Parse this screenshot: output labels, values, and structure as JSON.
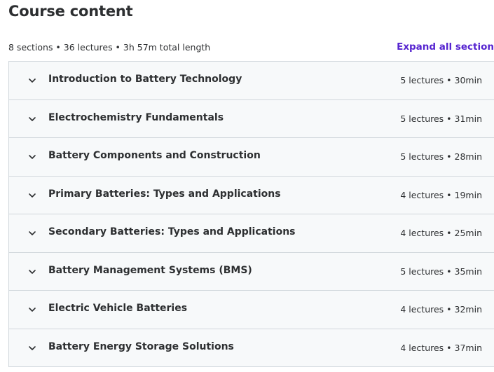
{
  "header": {
    "title": "Course content",
    "summary": "8 sections • 36 lectures • 3h 57m total length",
    "expand_label": "Expand all section"
  },
  "sections": [
    {
      "title": "Introduction to Battery Technology",
      "meta": "5 lectures • 30min"
    },
    {
      "title": "Electrochemistry Fundamentals",
      "meta": "5 lectures • 31min"
    },
    {
      "title": "Battery Components and Construction",
      "meta": "5 lectures • 28min"
    },
    {
      "title": "Primary Batteries: Types and Applications",
      "meta": "4 lectures • 19min"
    },
    {
      "title": "Secondary Batteries: Types and Applications",
      "meta": "4 lectures • 25min"
    },
    {
      "title": "Battery Management Systems (BMS)",
      "meta": "5 lectures • 35min"
    },
    {
      "title": "Electric Vehicle Batteries",
      "meta": "4 lectures • 32min"
    },
    {
      "title": "Battery Energy Storage Solutions",
      "meta": "4 lectures • 37min"
    }
  ],
  "icons": {
    "section_toggle": "chevron-down-icon"
  },
  "colors": {
    "accent": "#5624d0",
    "section_bg": "#f7f9fa",
    "border": "#d1d7dc",
    "text": "#2d2f31"
  }
}
